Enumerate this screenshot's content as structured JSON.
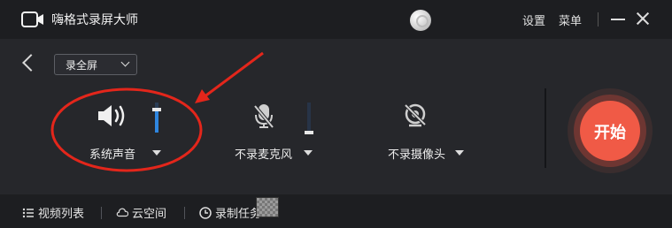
{
  "app": {
    "title": "嗨格式录屏大师"
  },
  "header": {
    "settings_label": "设置",
    "menu_label": "菜单"
  },
  "toolbar": {
    "mode_selected": "录全屏"
  },
  "controls": {
    "system_audio_label": "系统声音",
    "system_audio_level": 0.75,
    "microphone_label": "不录麦克风",
    "microphone_level": 0,
    "camera_label": "不录摄像头"
  },
  "actions": {
    "start_label": "开始"
  },
  "bottom_nav": {
    "video_list_label": "视频列表",
    "cloud_label": "云空间",
    "tasks_label": "录制任务"
  },
  "colors": {
    "primary": "#f05a46",
    "accent": "#2f86e0",
    "annotation": "#e3261b"
  },
  "icons": {
    "logo": "camera-logo-icon",
    "speaker": "speaker-icon",
    "microphone": "microphone-muted-icon",
    "camera": "camera-muted-icon",
    "video_list": "list-icon",
    "cloud": "cloud-icon",
    "tasks": "clock-icon"
  }
}
